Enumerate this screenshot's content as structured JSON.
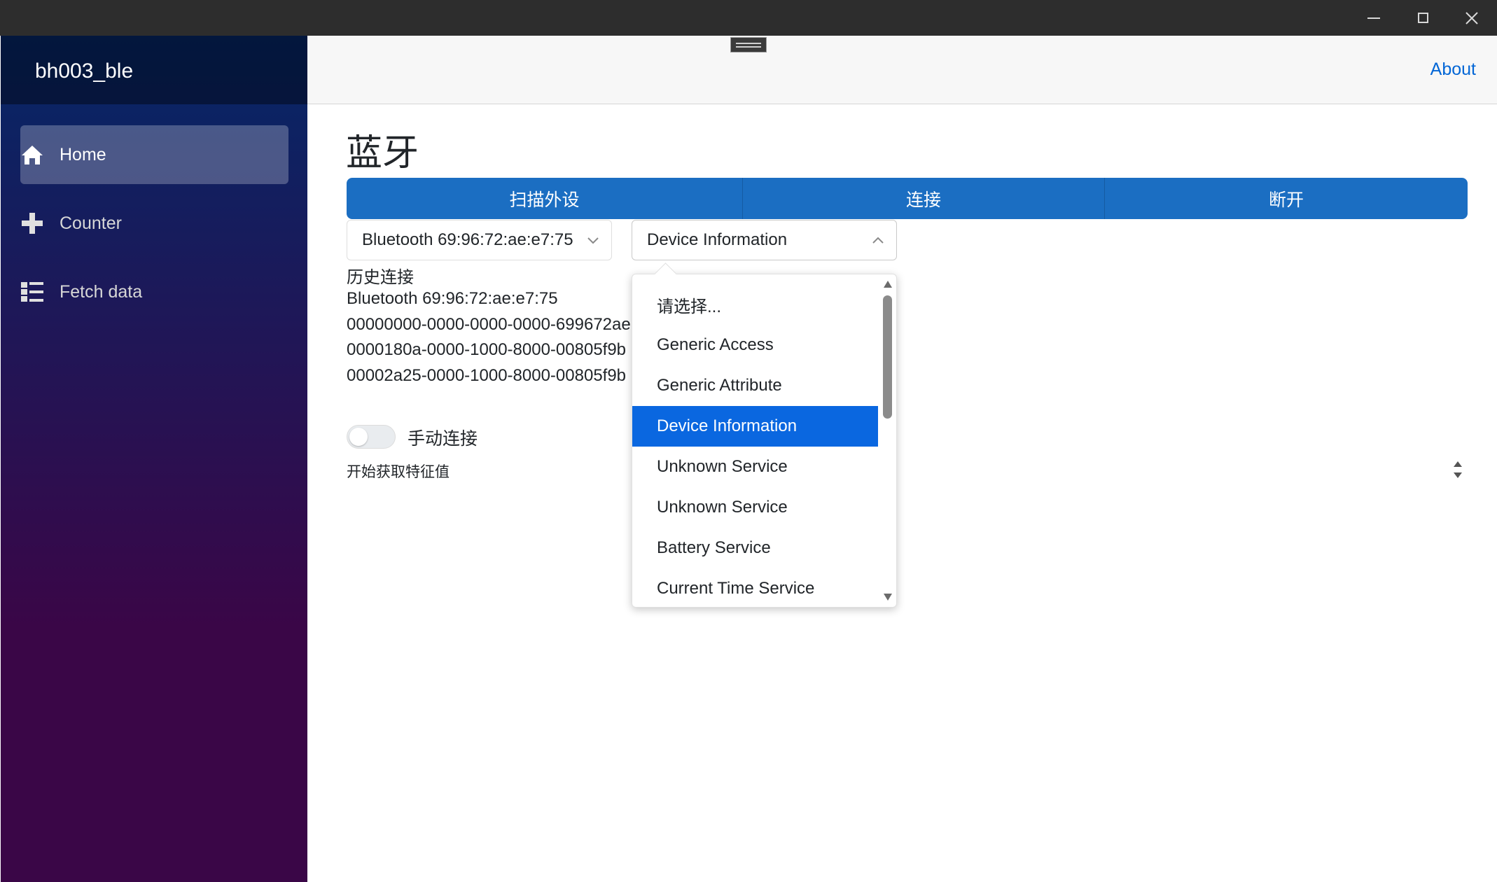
{
  "window": {
    "minimize_icon": "minimize-icon",
    "maximize_icon": "maximize-icon",
    "close_icon": "close-icon"
  },
  "sidebar": {
    "brand": "bh003_ble",
    "items": [
      {
        "label": "Home",
        "icon": "home-icon",
        "active": true
      },
      {
        "label": "Counter",
        "icon": "plus-icon",
        "active": false
      },
      {
        "label": "Fetch data",
        "icon": "list-icon",
        "active": false
      }
    ]
  },
  "top_row": {
    "about": "About"
  },
  "main": {
    "title": "蓝牙",
    "buttons": {
      "scan": "扫描外设",
      "connect": "连接",
      "disconnect": "断开"
    },
    "device_select": {
      "value": "Bluetooth 69:96:72:ae:e7:75"
    },
    "service_select": {
      "value": "Device Information"
    },
    "history": {
      "heading": "历史连接",
      "lines": [
        "Bluetooth 69:96:72:ae:e7:75",
        "00000000-0000-0000-0000-699672ae",
        "0000180a-0000-1000-8000-00805f9b",
        "00002a25-0000-1000-8000-00805f9b"
      ]
    },
    "toggle": {
      "label": "手动连接",
      "on": false
    },
    "status": "开始获取特征值"
  },
  "dropdown": {
    "options": [
      "请选择...",
      "Generic Access",
      "Generic Attribute",
      "Device Information",
      "Unknown Service",
      "Unknown Service",
      "Battery Service",
      "Current Time Service"
    ],
    "selected_index": 3
  },
  "colors": {
    "accent": "#1b6ec2",
    "selection": "#0a67e0",
    "link": "#0366d6",
    "sidebar_top": "#052767",
    "sidebar_bottom": "#3a0647"
  }
}
